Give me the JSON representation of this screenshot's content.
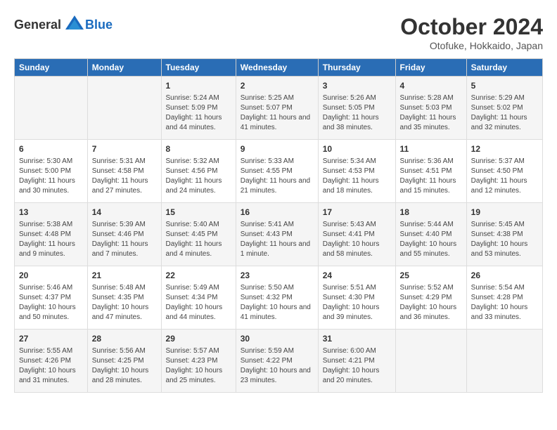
{
  "header": {
    "logo_general": "General",
    "logo_blue": "Blue",
    "month": "October 2024",
    "location": "Otofuke, Hokkaido, Japan"
  },
  "days_of_week": [
    "Sunday",
    "Monday",
    "Tuesday",
    "Wednesday",
    "Thursday",
    "Friday",
    "Saturday"
  ],
  "weeks": [
    [
      {
        "day": "",
        "info": ""
      },
      {
        "day": "",
        "info": ""
      },
      {
        "day": "1",
        "info": "Sunrise: 5:24 AM\nSunset: 5:09 PM\nDaylight: 11 hours and 44 minutes."
      },
      {
        "day": "2",
        "info": "Sunrise: 5:25 AM\nSunset: 5:07 PM\nDaylight: 11 hours and 41 minutes."
      },
      {
        "day": "3",
        "info": "Sunrise: 5:26 AM\nSunset: 5:05 PM\nDaylight: 11 hours and 38 minutes."
      },
      {
        "day": "4",
        "info": "Sunrise: 5:28 AM\nSunset: 5:03 PM\nDaylight: 11 hours and 35 minutes."
      },
      {
        "day": "5",
        "info": "Sunrise: 5:29 AM\nSunset: 5:02 PM\nDaylight: 11 hours and 32 minutes."
      }
    ],
    [
      {
        "day": "6",
        "info": "Sunrise: 5:30 AM\nSunset: 5:00 PM\nDaylight: 11 hours and 30 minutes."
      },
      {
        "day": "7",
        "info": "Sunrise: 5:31 AM\nSunset: 4:58 PM\nDaylight: 11 hours and 27 minutes."
      },
      {
        "day": "8",
        "info": "Sunrise: 5:32 AM\nSunset: 4:56 PM\nDaylight: 11 hours and 24 minutes."
      },
      {
        "day": "9",
        "info": "Sunrise: 5:33 AM\nSunset: 4:55 PM\nDaylight: 11 hours and 21 minutes."
      },
      {
        "day": "10",
        "info": "Sunrise: 5:34 AM\nSunset: 4:53 PM\nDaylight: 11 hours and 18 minutes."
      },
      {
        "day": "11",
        "info": "Sunrise: 5:36 AM\nSunset: 4:51 PM\nDaylight: 11 hours and 15 minutes."
      },
      {
        "day": "12",
        "info": "Sunrise: 5:37 AM\nSunset: 4:50 PM\nDaylight: 11 hours and 12 minutes."
      }
    ],
    [
      {
        "day": "13",
        "info": "Sunrise: 5:38 AM\nSunset: 4:48 PM\nDaylight: 11 hours and 9 minutes."
      },
      {
        "day": "14",
        "info": "Sunrise: 5:39 AM\nSunset: 4:46 PM\nDaylight: 11 hours and 7 minutes."
      },
      {
        "day": "15",
        "info": "Sunrise: 5:40 AM\nSunset: 4:45 PM\nDaylight: 11 hours and 4 minutes."
      },
      {
        "day": "16",
        "info": "Sunrise: 5:41 AM\nSunset: 4:43 PM\nDaylight: 11 hours and 1 minute."
      },
      {
        "day": "17",
        "info": "Sunrise: 5:43 AM\nSunset: 4:41 PM\nDaylight: 10 hours and 58 minutes."
      },
      {
        "day": "18",
        "info": "Sunrise: 5:44 AM\nSunset: 4:40 PM\nDaylight: 10 hours and 55 minutes."
      },
      {
        "day": "19",
        "info": "Sunrise: 5:45 AM\nSunset: 4:38 PM\nDaylight: 10 hours and 53 minutes."
      }
    ],
    [
      {
        "day": "20",
        "info": "Sunrise: 5:46 AM\nSunset: 4:37 PM\nDaylight: 10 hours and 50 minutes."
      },
      {
        "day": "21",
        "info": "Sunrise: 5:48 AM\nSunset: 4:35 PM\nDaylight: 10 hours and 47 minutes."
      },
      {
        "day": "22",
        "info": "Sunrise: 5:49 AM\nSunset: 4:34 PM\nDaylight: 10 hours and 44 minutes."
      },
      {
        "day": "23",
        "info": "Sunrise: 5:50 AM\nSunset: 4:32 PM\nDaylight: 10 hours and 41 minutes."
      },
      {
        "day": "24",
        "info": "Sunrise: 5:51 AM\nSunset: 4:30 PM\nDaylight: 10 hours and 39 minutes."
      },
      {
        "day": "25",
        "info": "Sunrise: 5:52 AM\nSunset: 4:29 PM\nDaylight: 10 hours and 36 minutes."
      },
      {
        "day": "26",
        "info": "Sunrise: 5:54 AM\nSunset: 4:28 PM\nDaylight: 10 hours and 33 minutes."
      }
    ],
    [
      {
        "day": "27",
        "info": "Sunrise: 5:55 AM\nSunset: 4:26 PM\nDaylight: 10 hours and 31 minutes."
      },
      {
        "day": "28",
        "info": "Sunrise: 5:56 AM\nSunset: 4:25 PM\nDaylight: 10 hours and 28 minutes."
      },
      {
        "day": "29",
        "info": "Sunrise: 5:57 AM\nSunset: 4:23 PM\nDaylight: 10 hours and 25 minutes."
      },
      {
        "day": "30",
        "info": "Sunrise: 5:59 AM\nSunset: 4:22 PM\nDaylight: 10 hours and 23 minutes."
      },
      {
        "day": "31",
        "info": "Sunrise: 6:00 AM\nSunset: 4:21 PM\nDaylight: 10 hours and 20 minutes."
      },
      {
        "day": "",
        "info": ""
      },
      {
        "day": "",
        "info": ""
      }
    ]
  ]
}
